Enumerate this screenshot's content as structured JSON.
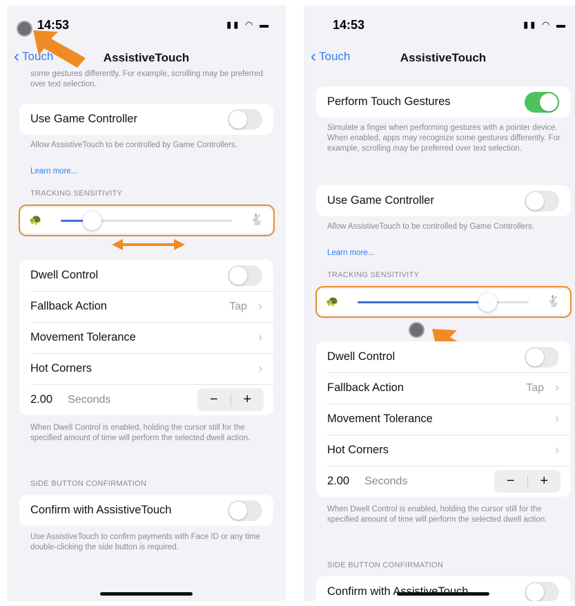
{
  "status": {
    "time": "14:53"
  },
  "nav": {
    "back_label": "Touch",
    "title": "AssistiveTouch"
  },
  "left": {
    "top_note_fragment": "some gestures differently. For example, scrolling may be preferred over text selection.",
    "game_controller": {
      "label": "Use Game Controller",
      "note": "Allow AssistiveTouch to be controlled by Game Controllers.",
      "learn_more": "Learn more..."
    },
    "tracking_header": "TRACKING SENSITIVITY",
    "tracking_level": 0.18,
    "dwell": {
      "dwell_control": "Dwell Control",
      "fallback_action": "Fallback Action",
      "fallback_value": "Tap",
      "movement_tolerance": "Movement Tolerance",
      "hot_corners": "Hot Corners",
      "time_value": "2.00",
      "time_unit": "Seconds",
      "minus": "−",
      "plus": "+",
      "note": "When Dwell Control is enabled, holding the cursor still for the specified amount of time will perform the selected dwell action."
    },
    "side_header": "SIDE BUTTON CONFIRMATION",
    "confirm": {
      "label": "Confirm with AssistiveTouch",
      "note": "Use AssistiveTouch to confirm payments with Face ID or any time double-clicking the side button is required."
    }
  },
  "right": {
    "perform_gestures": {
      "label": "Perform Touch Gestures",
      "on": true,
      "note": "Simulate a finger when performing gestures with a pointer device. When enabled, apps may recognize some gestures differently. For example, scrolling may be preferred over text selection."
    },
    "game_controller": {
      "label": "Use Game Controller",
      "note": "Allow AssistiveTouch to be controlled by Game Controllers.",
      "learn_more": "Learn more..."
    },
    "tracking_header": "TRACKING SENSITIVITY",
    "tracking_level": 0.76,
    "dwell": {
      "dwell_control": "Dwell Control",
      "fallback_action": "Fallback Action",
      "fallback_value": "Tap",
      "movement_tolerance": "Movement Tolerance",
      "hot_corners": "Hot Corners",
      "time_value": "2.00",
      "time_unit": "Seconds",
      "minus": "−",
      "plus": "+",
      "note": "When Dwell Control is enabled, holding the cursor still for the specified amount of time will perform the selected dwell action."
    },
    "side_header": "SIDE BUTTON CONFIRMATION",
    "confirm": {
      "label": "Confirm with AssistiveTouch"
    }
  },
  "icons": {
    "back": "chevron-left-icon",
    "chevron": "chevron-right-icon",
    "turtle": "turtle-icon",
    "rabbit": "rabbit-icon",
    "cursor": "pointer-cursor-icon",
    "annotation_arrow": "orange-arrow-icon",
    "drag_arrow": "double-arrow-icon"
  },
  "colors": {
    "accent": "#2f7df6",
    "toggle_on": "#4cc35f",
    "highlight": "#f08a24",
    "slider_fill": "#3b6fd8"
  }
}
